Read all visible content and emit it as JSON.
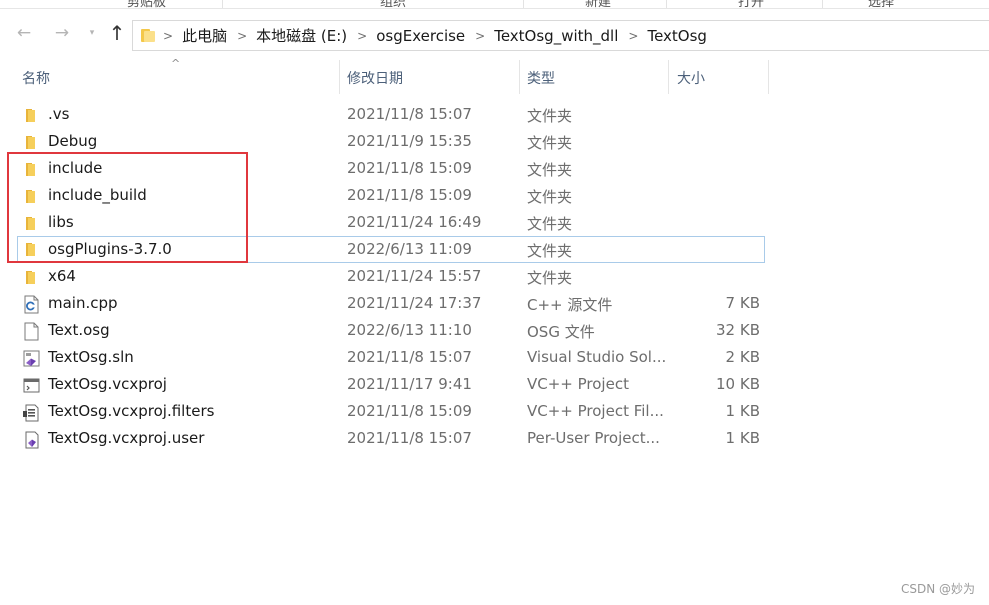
{
  "ribbon": {
    "fragments": [
      "剪贴板",
      "组织",
      "新建",
      "打开",
      "选择"
    ]
  },
  "nav": {
    "back_glyph": "←",
    "forward_glyph": "→",
    "dropdown_glyph": "▾",
    "up_glyph": "↑"
  },
  "breadcrumb": [
    "此电脑",
    "本地磁盘 (E:)",
    "osgExercise",
    "TextOsg_with_dll",
    "TextOsg"
  ],
  "columns": {
    "name": "名称",
    "date": "修改日期",
    "type": "类型",
    "size": "大小",
    "sort_indicator": "^"
  },
  "files": [
    {
      "name": ".vs",
      "date": "2021/11/8 15:07",
      "type": "文件夹",
      "size": "",
      "icon": "folder-icon"
    },
    {
      "name": "Debug",
      "date": "2021/11/9 15:35",
      "type": "文件夹",
      "size": "",
      "icon": "folder-icon"
    },
    {
      "name": "include",
      "date": "2021/11/8 15:09",
      "type": "文件夹",
      "size": "",
      "icon": "folder-icon"
    },
    {
      "name": "include_build",
      "date": "2021/11/8 15:09",
      "type": "文件夹",
      "size": "",
      "icon": "folder-icon"
    },
    {
      "name": "libs",
      "date": "2021/11/24 16:49",
      "type": "文件夹",
      "size": "",
      "icon": "folder-icon"
    },
    {
      "name": "osgPlugins-3.7.0",
      "date": "2022/6/13 11:09",
      "type": "文件夹",
      "size": "",
      "icon": "folder-icon",
      "selected": true
    },
    {
      "name": "x64",
      "date": "2021/11/24 15:57",
      "type": "文件夹",
      "size": "",
      "icon": "folder-icon"
    },
    {
      "name": "main.cpp",
      "date": "2021/11/24 17:37",
      "type": "C++ 源文件",
      "size": "7 KB",
      "icon": "cpp-file-icon"
    },
    {
      "name": "Text.osg",
      "date": "2022/6/13 11:10",
      "type": "OSG 文件",
      "size": "32 KB",
      "icon": "blank-file-icon"
    },
    {
      "name": "TextOsg.sln",
      "date": "2021/11/8 15:07",
      "type": "Visual Studio Sol...",
      "size": "2 KB",
      "icon": "visual-studio-solution-icon"
    },
    {
      "name": "TextOsg.vcxproj",
      "date": "2021/11/17 9:41",
      "type": "VC++ Project",
      "size": "10 KB",
      "icon": "vcxproj-file-icon"
    },
    {
      "name": "TextOsg.vcxproj.filters",
      "date": "2021/11/8 15:09",
      "type": "VC++ Project Fil...",
      "size": "1 KB",
      "icon": "filters-file-icon"
    },
    {
      "name": "TextOsg.vcxproj.user",
      "date": "2021/11/8 15:07",
      "type": "Per-User Project...",
      "size": "1 KB",
      "icon": "user-project-file-icon"
    }
  ],
  "colors": {
    "highlight_box": "#e0373d",
    "selection_border": "#a9cbe9",
    "folder": "#f4c84a"
  },
  "watermark": "CSDN @妙为"
}
